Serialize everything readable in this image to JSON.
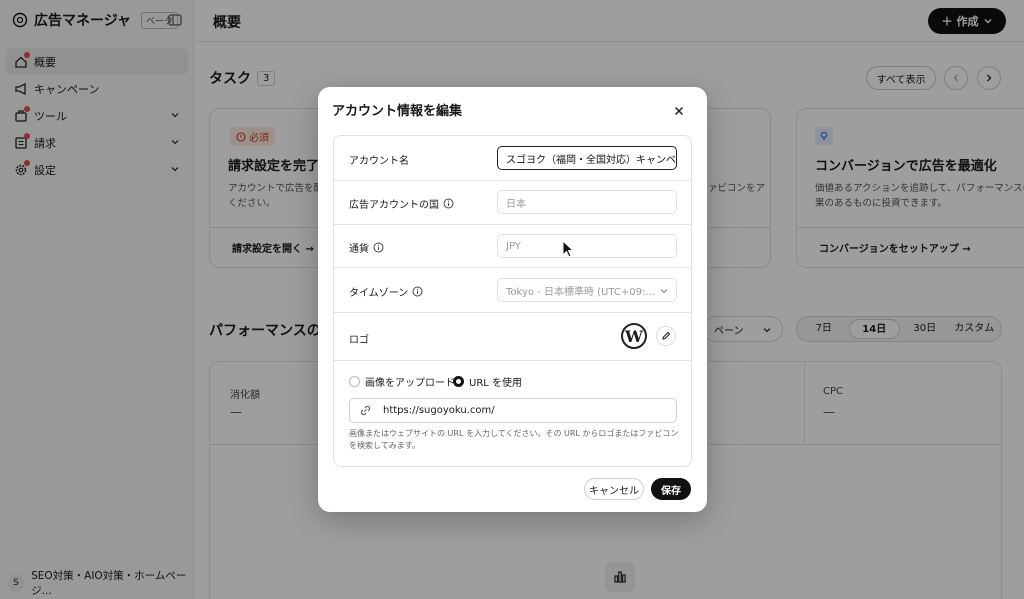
{
  "sidebar": {
    "app_title": "広告マネージャ",
    "beta_label": "ベータ",
    "items": [
      {
        "label": "概要"
      },
      {
        "label": "キャンペーン"
      },
      {
        "label": "ツール"
      },
      {
        "label": "請求"
      },
      {
        "label": "設定"
      }
    ],
    "account_initial": "S",
    "account_name": "SEO対策・AIO対策・ホームページ..."
  },
  "header": {
    "title": "概要",
    "create_label": "作成"
  },
  "tasks": {
    "title": "タスク",
    "count": "3",
    "show_all": "すべて表示",
    "cards": [
      {
        "badge": "必須",
        "title": "請求設定を完了",
        "desc": "アカウントで広告を配信\nください。",
        "link": "請求設定を開く →"
      },
      {
        "desc": "ァビコンをア",
        "link": ""
      },
      {
        "title": "コンバージョンで広告を最適化",
        "desc": "価値あるアクションを追跡して、パフォーマンスの\n果のあるものに投資できます。",
        "link": "コンバージョンをセットアップ →"
      }
    ]
  },
  "performance": {
    "title": "パフォーマンスの推移",
    "dropdown": "ペーン",
    "ranges": [
      "7日",
      "14日",
      "30日",
      "カスタム"
    ],
    "selected_range": "14日",
    "metrics": [
      {
        "label": "消化額",
        "value": "—"
      },
      {
        "label": "CPC",
        "value": "—"
      }
    ]
  },
  "modal": {
    "title": "アカウント情報を編集",
    "fields": {
      "account_name_label": "アカウント名",
      "account_name_value": "スゴヨク（福岡・全国対応）キャンペーン",
      "country_label": "広告アカウントの国",
      "country_value": "日本",
      "currency_label": "通貨",
      "currency_value": "JPY",
      "timezone_label": "タイムゾーン",
      "timezone_value": "Tokyo - 日本標準時 (UTC+09:...",
      "logo_label": "ロゴ",
      "logo_glyph": "W",
      "radio_upload": "画像をアップロード",
      "radio_url": "URL を使用",
      "url_value": "https://sugoyoku.com/",
      "help_text": "画像またはウェブサイトの URL を入力してください。その URL からロゴまたはファビコンを検索してみます。"
    },
    "cancel_label": "キャンセル",
    "save_label": "保存"
  }
}
